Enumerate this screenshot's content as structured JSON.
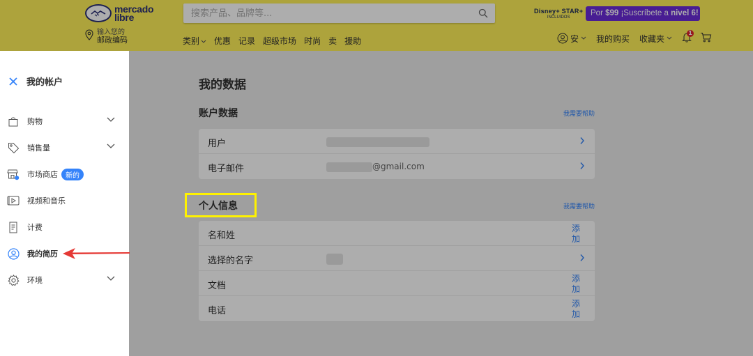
{
  "header": {
    "logo": {
      "line1": "mercado",
      "line2": "libre"
    },
    "location": {
      "small": "输入您的",
      "main": "邮政编码"
    },
    "search": {
      "placeholder": "搜索产品、品牌等..."
    },
    "nav": [
      "类别",
      "优惠",
      "记录",
      "超级市场",
      "时尚",
      "卖",
      "援助"
    ],
    "disney": {
      "top": "Disney+ STAR+",
      "bottom": "INCLUIDOS"
    },
    "promo": {
      "pre": "Por ",
      "price": "$99",
      "mid": " ¡Suscríbete a ",
      "level": "nivel 6!"
    },
    "user": {
      "name": "安",
      "purchases": "我的购买",
      "favorites": "收藏夹",
      "notifications": "1"
    }
  },
  "sidebar": {
    "title": "我的帐户",
    "items": [
      {
        "label": "购物",
        "icon": "shopping-bag-icon",
        "chevron": true
      },
      {
        "label": "销售量",
        "icon": "tag-icon",
        "chevron": true
      },
      {
        "label": "市场商店",
        "icon": "store-icon",
        "badge": "新的"
      },
      {
        "label": "视频和音乐",
        "icon": "media-icon"
      },
      {
        "label": "计费",
        "icon": "receipt-icon"
      },
      {
        "label": "我的简历",
        "icon": "profile-icon",
        "active": true
      },
      {
        "label": "环境",
        "icon": "gear-icon",
        "chevron": true
      }
    ]
  },
  "main": {
    "title": "我的数据",
    "account": {
      "title": "账户数据",
      "help": "我需要帮助",
      "rows": [
        {
          "label": "用户",
          "value": ""
        },
        {
          "label": "电子邮件",
          "value": "@gmail.com"
        }
      ]
    },
    "personal": {
      "title": "个人信息",
      "help": "我需要帮助",
      "rows": [
        {
          "label": "名和姓",
          "action": "添加"
        },
        {
          "label": "选择的名字",
          "action": ""
        },
        {
          "label": "文档",
          "action": "添加"
        },
        {
          "label": "电话",
          "action": "添加"
        }
      ]
    }
  },
  "colors": {
    "header_yellow": "#fff159",
    "accent_blue": "#3483fa",
    "promo_purple": "#6b2bd9",
    "highlight_yellow": "#fff200",
    "arrow_red": "#e53935"
  }
}
